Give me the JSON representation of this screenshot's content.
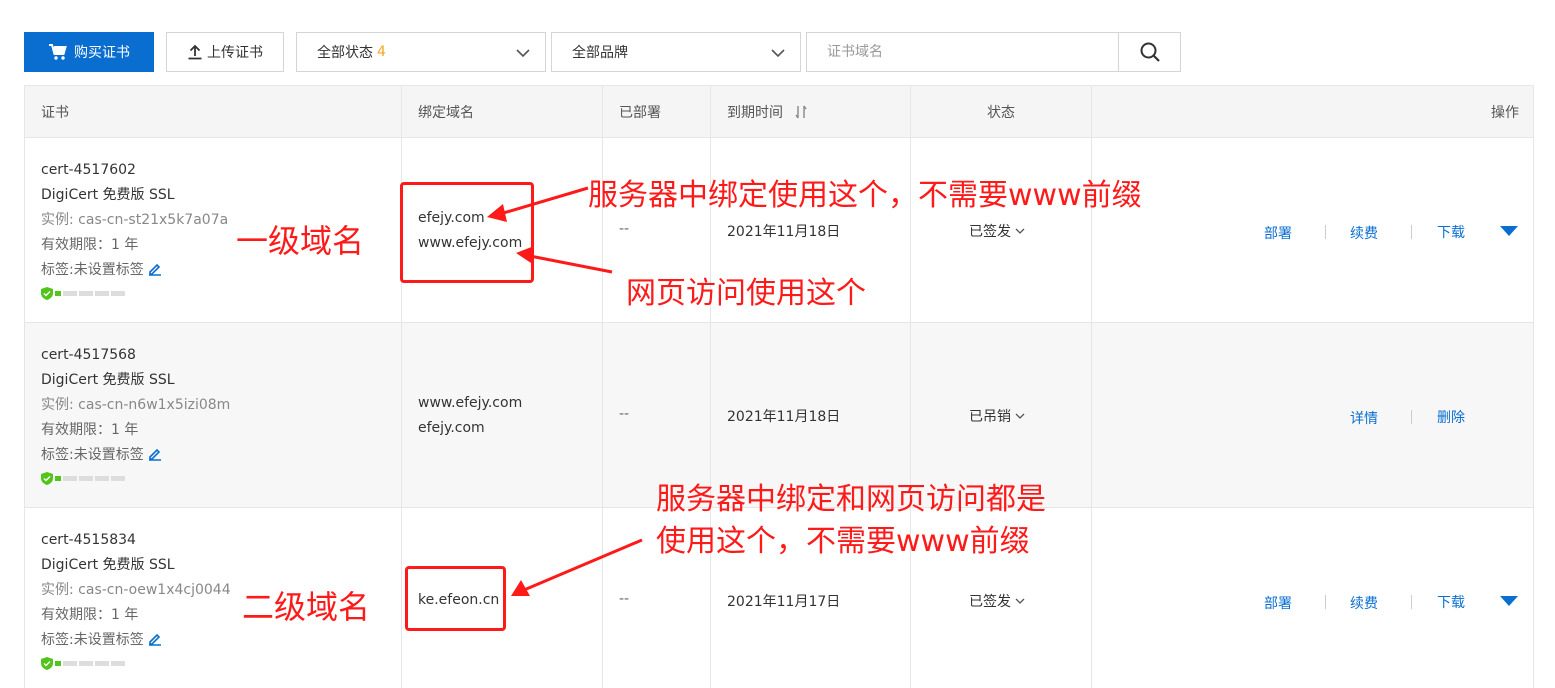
{
  "toolbar": {
    "buy_label": "购买证书",
    "upload_label": "上传证书",
    "status_filter": {
      "label": "全部状态",
      "count": "4"
    },
    "brand_filter": {
      "label": "全部品牌"
    },
    "search_placeholder": "证书域名"
  },
  "table": {
    "headers": {
      "cert": "证书",
      "domain": "绑定域名",
      "deployed": "已部署",
      "expiry": "到期时间",
      "status": "状态",
      "actions": "操作"
    },
    "rows": [
      {
        "id": "cert-4517602",
        "name": "DigiCert 免费版 SSL",
        "instance": "实例: cas-cn-st21x5k7a07a",
        "validity": "有效期限：1 年",
        "tag": "标签:未设置标签",
        "domains": [
          "efejy.com",
          "www.efejy.com"
        ],
        "deployed": "--",
        "expiry": "2021年11月18日",
        "status": "已签发",
        "actions": [
          "部署",
          "续费",
          "下载"
        ]
      },
      {
        "id": "cert-4517568",
        "name": "DigiCert 免费版 SSL",
        "instance": "实例: cas-cn-n6w1x5izi08m",
        "validity": "有效期限：1 年",
        "tag": "标签:未设置标签",
        "domains": [
          "www.efejy.com",
          "efejy.com"
        ],
        "deployed": "--",
        "expiry": "2021年11月18日",
        "status": "已吊销",
        "actions": [
          "详情",
          "删除"
        ]
      },
      {
        "id": "cert-4515834",
        "name": "DigiCert 免费版 SSL",
        "instance": "实例: cas-cn-oew1x4cj0044",
        "validity": "有效期限：1 年",
        "tag": "标签:未设置标签",
        "domains": [
          "ke.efeon.cn"
        ],
        "deployed": "--",
        "expiry": "2021年11月17日",
        "status": "已签发",
        "actions": [
          "部署",
          "续费",
          "下载"
        ]
      }
    ]
  },
  "annotations": {
    "level1": "一级域名",
    "level2": "二级域名",
    "server_bind": "服务器中绑定使用这个，不需要www前缀",
    "web_access": "网页访问使用这个",
    "both_line1": "服务器中绑定和网页访问都是",
    "both_line2": "使用这个，不需要www前缀"
  },
  "colors": {
    "primary": "#0a6ed1",
    "annotation": "#ff1a1a",
    "count": "#f5a623",
    "shield": "#52c41a"
  },
  "icons": [
    "cart-icon",
    "upload-icon",
    "chevron-down-icon",
    "search-icon",
    "sort-icon",
    "edit-icon",
    "shield-icon",
    "triangle-down-icon"
  ]
}
